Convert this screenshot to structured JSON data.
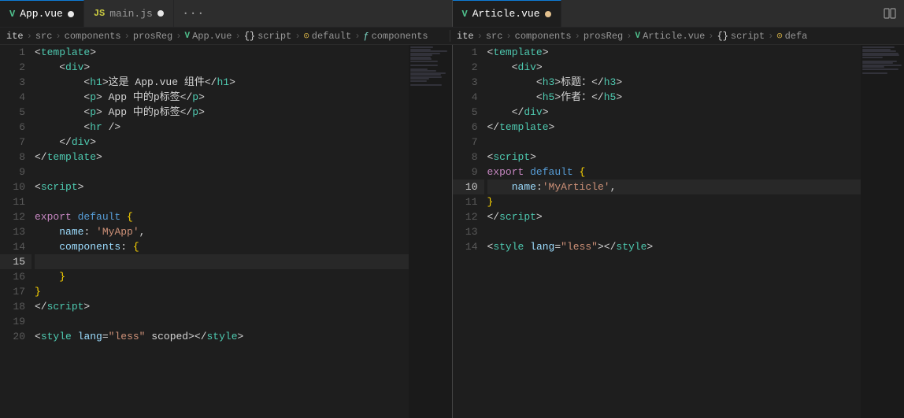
{
  "tabs": {
    "left": [
      {
        "id": "app-vue",
        "icon": "vue",
        "label": "App.vue",
        "active": true,
        "modified": false
      },
      {
        "id": "main-js",
        "icon": "js",
        "label": "main.js",
        "active": false,
        "modified": false
      }
    ],
    "right": [
      {
        "id": "article-vue",
        "icon": "vue",
        "label": "Article.vue",
        "active": true,
        "modified": true
      }
    ],
    "more_label": "···"
  },
  "breadcrumbs": {
    "left": [
      {
        "text": "ite",
        "type": "text"
      },
      {
        "text": ">",
        "type": "sep"
      },
      {
        "text": "src",
        "type": "text"
      },
      {
        "text": ">",
        "type": "sep"
      },
      {
        "text": "components",
        "type": "text"
      },
      {
        "text": ">",
        "type": "sep"
      },
      {
        "text": "prosReg",
        "type": "text"
      },
      {
        "text": ">",
        "type": "sep"
      },
      {
        "text": "V",
        "type": "vue-icon"
      },
      {
        "text": "App.vue",
        "type": "text"
      },
      {
        "text": ">",
        "type": "sep"
      },
      {
        "text": "{}",
        "type": "bracket"
      },
      {
        "text": "script",
        "type": "text"
      },
      {
        "text": ">",
        "type": "sep"
      },
      {
        "text": "⊙",
        "type": "obj-icon"
      },
      {
        "text": "default",
        "type": "text"
      },
      {
        "text": ">",
        "type": "sep"
      },
      {
        "text": "∿",
        "type": "func-icon"
      },
      {
        "text": "components",
        "type": "text"
      }
    ],
    "right": [
      {
        "text": "ite",
        "type": "text"
      },
      {
        "text": ">",
        "type": "sep"
      },
      {
        "text": "src",
        "type": "text"
      },
      {
        "text": ">",
        "type": "sep"
      },
      {
        "text": "components",
        "type": "text"
      },
      {
        "text": ">",
        "type": "sep"
      },
      {
        "text": "prosReg",
        "type": "text"
      },
      {
        "text": ">",
        "type": "sep"
      },
      {
        "text": "V",
        "type": "vue-icon"
      },
      {
        "text": "Article.vue",
        "type": "text"
      },
      {
        "text": ">",
        "type": "sep"
      },
      {
        "text": "{}",
        "type": "bracket"
      },
      {
        "text": "script",
        "type": "text"
      },
      {
        "text": ">",
        "type": "sep"
      },
      {
        "text": "⊙",
        "type": "obj-icon"
      },
      {
        "text": "defa",
        "type": "text"
      }
    ]
  },
  "left_code": [
    {
      "num": 1,
      "tokens": [
        {
          "t": "<",
          "c": "c-bracket"
        },
        {
          "t": "template",
          "c": "c-tag"
        },
        {
          "t": ">",
          "c": "c-bracket"
        }
      ]
    },
    {
      "num": 2,
      "tokens": [
        {
          "t": "    <",
          "c": "c-bracket"
        },
        {
          "t": "div",
          "c": "c-tag"
        },
        {
          "t": ">",
          "c": "c-bracket"
        }
      ]
    },
    {
      "num": 3,
      "tokens": [
        {
          "t": "        <",
          "c": "c-bracket"
        },
        {
          "t": "h1",
          "c": "c-tag"
        },
        {
          "t": ">这是 App.vue 组件</",
          "c": "c-text"
        },
        {
          "t": "h1",
          "c": "c-tag"
        },
        {
          "t": ">",
          "c": "c-bracket"
        }
      ]
    },
    {
      "num": 4,
      "tokens": [
        {
          "t": "        <",
          "c": "c-bracket"
        },
        {
          "t": "p",
          "c": "c-tag"
        },
        {
          "t": "> App 中的p标签</",
          "c": "c-text"
        },
        {
          "t": "p",
          "c": "c-tag"
        },
        {
          "t": ">",
          "c": "c-bracket"
        }
      ]
    },
    {
      "num": 5,
      "tokens": [
        {
          "t": "        <",
          "c": "c-bracket"
        },
        {
          "t": "p",
          "c": "c-tag"
        },
        {
          "t": "> App 中的p标签</",
          "c": "c-text"
        },
        {
          "t": "p",
          "c": "c-tag"
        },
        {
          "t": ">",
          "c": "c-bracket"
        }
      ]
    },
    {
      "num": 6,
      "tokens": [
        {
          "t": "        <",
          "c": "c-bracket"
        },
        {
          "t": "hr",
          "c": "c-tag"
        },
        {
          "t": " />",
          "c": "c-bracket"
        }
      ]
    },
    {
      "num": 7,
      "tokens": [
        {
          "t": "    </",
          "c": "c-bracket"
        },
        {
          "t": "div",
          "c": "c-tag"
        },
        {
          "t": ">",
          "c": "c-bracket"
        }
      ]
    },
    {
      "num": 8,
      "tokens": [
        {
          "t": "</",
          "c": "c-bracket"
        },
        {
          "t": "template",
          "c": "c-tag"
        },
        {
          "t": ">",
          "c": "c-bracket"
        }
      ]
    },
    {
      "num": 9,
      "tokens": []
    },
    {
      "num": 10,
      "tokens": [
        {
          "t": "<",
          "c": "c-bracket"
        },
        {
          "t": "script",
          "c": "c-tag"
        },
        {
          "t": ">",
          "c": "c-bracket"
        }
      ]
    },
    {
      "num": 11,
      "tokens": []
    },
    {
      "num": 12,
      "tokens": [
        {
          "t": "export ",
          "c": "c-export"
        },
        {
          "t": "default ",
          "c": "c-default"
        },
        {
          "t": "{",
          "c": "c-brace"
        }
      ]
    },
    {
      "num": 13,
      "tokens": [
        {
          "t": "    ",
          "c": "c-text"
        },
        {
          "t": "name",
          "c": "c-name"
        },
        {
          "t": ": ",
          "c": "c-colon"
        },
        {
          "t": "'MyApp'",
          "c": "c-str-val"
        },
        {
          "t": ",",
          "c": "c-text"
        }
      ]
    },
    {
      "num": 14,
      "tokens": [
        {
          "t": "    ",
          "c": "c-text"
        },
        {
          "t": "components",
          "c": "c-components"
        },
        {
          "t": ": ",
          "c": "c-colon"
        },
        {
          "t": "{",
          "c": "c-brace"
        }
      ]
    },
    {
      "num": 15,
      "active": true,
      "tokens": [
        {
          "t": " ",
          "c": "c-text"
        }
      ]
    },
    {
      "num": 16,
      "tokens": [
        {
          "t": "    ",
          "c": "c-text"
        },
        {
          "t": "}",
          "c": "c-brace"
        }
      ]
    },
    {
      "num": 17,
      "tokens": [
        {
          "t": "}",
          "c": "c-brace"
        }
      ]
    },
    {
      "num": 18,
      "tokens": [
        {
          "t": "</",
          "c": "c-bracket"
        },
        {
          "t": "script",
          "c": "c-tag"
        },
        {
          "t": ">",
          "c": "c-bracket"
        }
      ]
    },
    {
      "num": 19,
      "tokens": []
    },
    {
      "num": 20,
      "tokens": [
        {
          "t": "<",
          "c": "c-bracket"
        },
        {
          "t": "style",
          "c": "c-tag"
        },
        {
          "t": " ",
          "c": "c-text"
        },
        {
          "t": "lang",
          "c": "c-attr"
        },
        {
          "t": "=",
          "c": "c-text"
        },
        {
          "t": "\"less\"",
          "c": "c-string"
        },
        {
          "t": " scoped></",
          "c": "c-text"
        },
        {
          "t": "style",
          "c": "c-tag"
        },
        {
          "t": ">",
          "c": "c-bracket"
        }
      ]
    }
  ],
  "right_code": [
    {
      "num": 1,
      "tokens": [
        {
          "t": "<",
          "c": "c-bracket"
        },
        {
          "t": "template",
          "c": "c-tag"
        },
        {
          "t": ">",
          "c": "c-bracket"
        }
      ]
    },
    {
      "num": 2,
      "tokens": [
        {
          "t": "    <",
          "c": "c-bracket"
        },
        {
          "t": "div",
          "c": "c-tag"
        },
        {
          "t": ">",
          "c": "c-bracket"
        }
      ]
    },
    {
      "num": 3,
      "tokens": [
        {
          "t": "        <",
          "c": "c-bracket"
        },
        {
          "t": "h3",
          "c": "c-tag"
        },
        {
          "t": ">标题：</",
          "c": "c-text"
        },
        {
          "t": "h3",
          "c": "c-tag"
        },
        {
          "t": ">",
          "c": "c-bracket"
        }
      ]
    },
    {
      "num": 4,
      "tokens": [
        {
          "t": "        <",
          "c": "c-bracket"
        },
        {
          "t": "h5",
          "c": "c-tag"
        },
        {
          "t": ">作者：</",
          "c": "c-text"
        },
        {
          "t": "h5",
          "c": "c-tag"
        },
        {
          "t": ">",
          "c": "c-bracket"
        }
      ]
    },
    {
      "num": 5,
      "tokens": [
        {
          "t": "    </",
          "c": "c-bracket"
        },
        {
          "t": "div",
          "c": "c-tag"
        },
        {
          "t": ">",
          "c": "c-bracket"
        }
      ]
    },
    {
      "num": 6,
      "tokens": [
        {
          "t": "</",
          "c": "c-bracket"
        },
        {
          "t": "template",
          "c": "c-tag"
        },
        {
          "t": ">",
          "c": "c-bracket"
        }
      ]
    },
    {
      "num": 7,
      "tokens": []
    },
    {
      "num": 8,
      "tokens": [
        {
          "t": "<",
          "c": "c-bracket"
        },
        {
          "t": "script",
          "c": "c-tag"
        },
        {
          "t": ">",
          "c": "c-bracket"
        }
      ]
    },
    {
      "num": 9,
      "tokens": [
        {
          "t": "export ",
          "c": "c-export"
        },
        {
          "t": "default ",
          "c": "c-default"
        },
        {
          "t": "{",
          "c": "c-brace"
        }
      ]
    },
    {
      "num": 10,
      "active": true,
      "tokens": [
        {
          "t": "    ",
          "c": "c-text"
        },
        {
          "t": "name",
          "c": "c-name"
        },
        {
          "t": ":",
          "c": "c-colon"
        },
        {
          "t": "'MyArticle'",
          "c": "c-str-val"
        },
        {
          "t": ",",
          "c": "c-text"
        }
      ]
    },
    {
      "num": 11,
      "tokens": [
        {
          "t": "}",
          "c": "c-brace"
        }
      ]
    },
    {
      "num": 12,
      "tokens": [
        {
          "t": "</",
          "c": "c-bracket"
        },
        {
          "t": "script",
          "c": "c-tag"
        },
        {
          "t": ">",
          "c": "c-bracket"
        }
      ]
    },
    {
      "num": 13,
      "tokens": []
    },
    {
      "num": 14,
      "tokens": [
        {
          "t": "<",
          "c": "c-bracket"
        },
        {
          "t": "style",
          "c": "c-tag"
        },
        {
          "t": " ",
          "c": "c-text"
        },
        {
          "t": "lang",
          "c": "c-attr"
        },
        {
          "t": "=",
          "c": "c-text"
        },
        {
          "t": "\"less\"",
          "c": "c-string"
        },
        {
          "t": "></",
          "c": "c-text"
        },
        {
          "t": "style",
          "c": "c-tag"
        },
        {
          "t": ">",
          "c": "c-bracket"
        }
      ]
    }
  ]
}
